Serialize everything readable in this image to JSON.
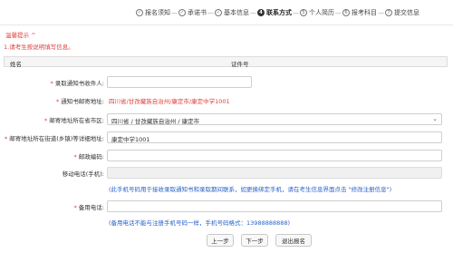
{
  "steps": [
    {
      "label": "报名须知",
      "icon": "check-icon",
      "mark": "✓",
      "active": false
    },
    {
      "label": "承诺书",
      "icon": "check-icon",
      "mark": "✓",
      "active": false
    },
    {
      "label": "基本信息",
      "icon": "check-icon",
      "mark": "✓",
      "active": false
    },
    {
      "label": "联系方式",
      "icon": "step-number-icon",
      "mark": "4",
      "active": true
    },
    {
      "label": "个人简历",
      "icon": "step-number-icon",
      "mark": "5",
      "active": false
    },
    {
      "label": "报考科目",
      "icon": "step-number-icon",
      "mark": "6",
      "active": false
    },
    {
      "label": "提交信息",
      "icon": "step-number-icon",
      "mark": "7",
      "active": false
    }
  ],
  "step_separator": "—",
  "tips": {
    "title": "温馨提示 ^",
    "text": "1.请考生按说明填写信息。"
  },
  "info": {
    "name_label": "姓名",
    "name_value": "",
    "id_label": "证件号",
    "id_value": ""
  },
  "form": {
    "recipient": {
      "label": "录取通知书收件人:",
      "value": ""
    },
    "notice_address": {
      "label": "通知书邮寄地址:",
      "value": "四川省/甘孜藏族自治州/康定市/康定中学1001"
    },
    "region": {
      "label": "邮寄地址所在省市区:",
      "value": "四川省 / 甘孜藏族自治州 / 康定市"
    },
    "street": {
      "label": "邮寄地址所在街道(乡镇)等详细地址:",
      "value": "康定中学1001"
    },
    "postcode": {
      "label": "邮政编码:",
      "value": ""
    },
    "mobile": {
      "label": "移动电话(手机):",
      "value": "",
      "note": "(此手机号码用于接收录取通知书和录取期间联系，如更换绑定手机，请在考生信息界面点击 \"修改注册信息\")"
    },
    "backup_phone": {
      "label": "备用电话:",
      "value": "",
      "note": "(备用电话不能与注册手机号码一样，手机号码格式：13988888888)"
    }
  },
  "buttons": {
    "prev": "上一步",
    "next": "下一步",
    "exit": "退出报名"
  },
  "colors": {
    "required": "#e04040",
    "note": "#2a63c9"
  }
}
